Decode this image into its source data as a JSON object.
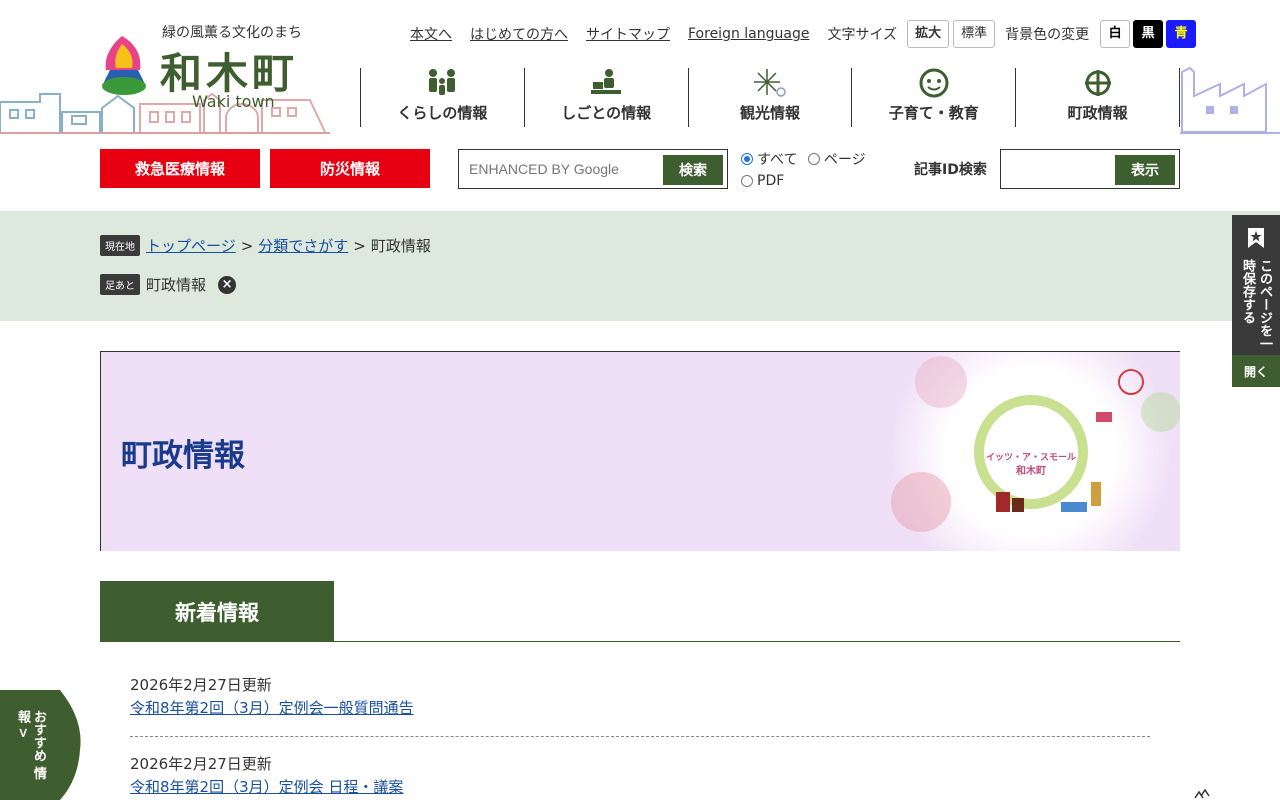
{
  "site": {
    "tagline": "緑の風薫る文化のまち",
    "name": "和木町",
    "name_en": "Waki town"
  },
  "utility": {
    "links": [
      "本文へ",
      "はじめての方へ",
      "サイトマップ",
      "Foreign language"
    ],
    "font_size_label": "文字サイズ",
    "font_size_large": "拡大",
    "font_size_normal": "標準",
    "bg_label": "背景色の変更",
    "bg_white": "白",
    "bg_black": "黒",
    "bg_blue": "青"
  },
  "gnav": [
    {
      "label": "くらしの情報",
      "icon": "people-icon"
    },
    {
      "label": "しごとの情報",
      "icon": "desk-worker-icon"
    },
    {
      "label": "観光情報",
      "icon": "fireworks-icon"
    },
    {
      "label": "子育て・教育",
      "icon": "child-face-icon"
    },
    {
      "label": "町政情報",
      "icon": "town-emblem-icon"
    }
  ],
  "quick": {
    "emergency": "救急医療情報",
    "disaster": "防災情報"
  },
  "search": {
    "placeholder": "ENHANCED BY Google",
    "button": "検索",
    "scope_all": "すべて",
    "scope_page": "ページ",
    "scope_pdf": "PDF"
  },
  "article_id": {
    "label": "記事ID検索",
    "button": "表示"
  },
  "breadcrumb": {
    "current_tag": "現在地",
    "items": [
      "トップページ",
      "分類でさがす"
    ],
    "current": "町政情報",
    "separator": ">"
  },
  "footprint": {
    "tag": "足あと",
    "item": "町政情報"
  },
  "hero": {
    "title": "町政情報",
    "badge_line1": "イッツ・ア・スモール",
    "badge_line2": "和木町"
  },
  "news": {
    "heading": "新着情報",
    "items": [
      {
        "date": "2026年2月27日更新",
        "title": "令和8年第2回（3月）定例会一般質問通告"
      },
      {
        "date": "2026年2月27日更新",
        "title": "令和8年第2回（3月）定例会 日程・議案"
      }
    ]
  },
  "side": {
    "save_label": "このページを一時保存する",
    "open_label": "開く",
    "recommend_label": "おすすめ 情報 >"
  },
  "colors": {
    "brand_green": "#3e5e2f",
    "emergency_red": "#e60012",
    "band_green": "#dce9dc",
    "hero_lavender": "#f0e0f7",
    "title_blue": "#1a3a8c"
  }
}
